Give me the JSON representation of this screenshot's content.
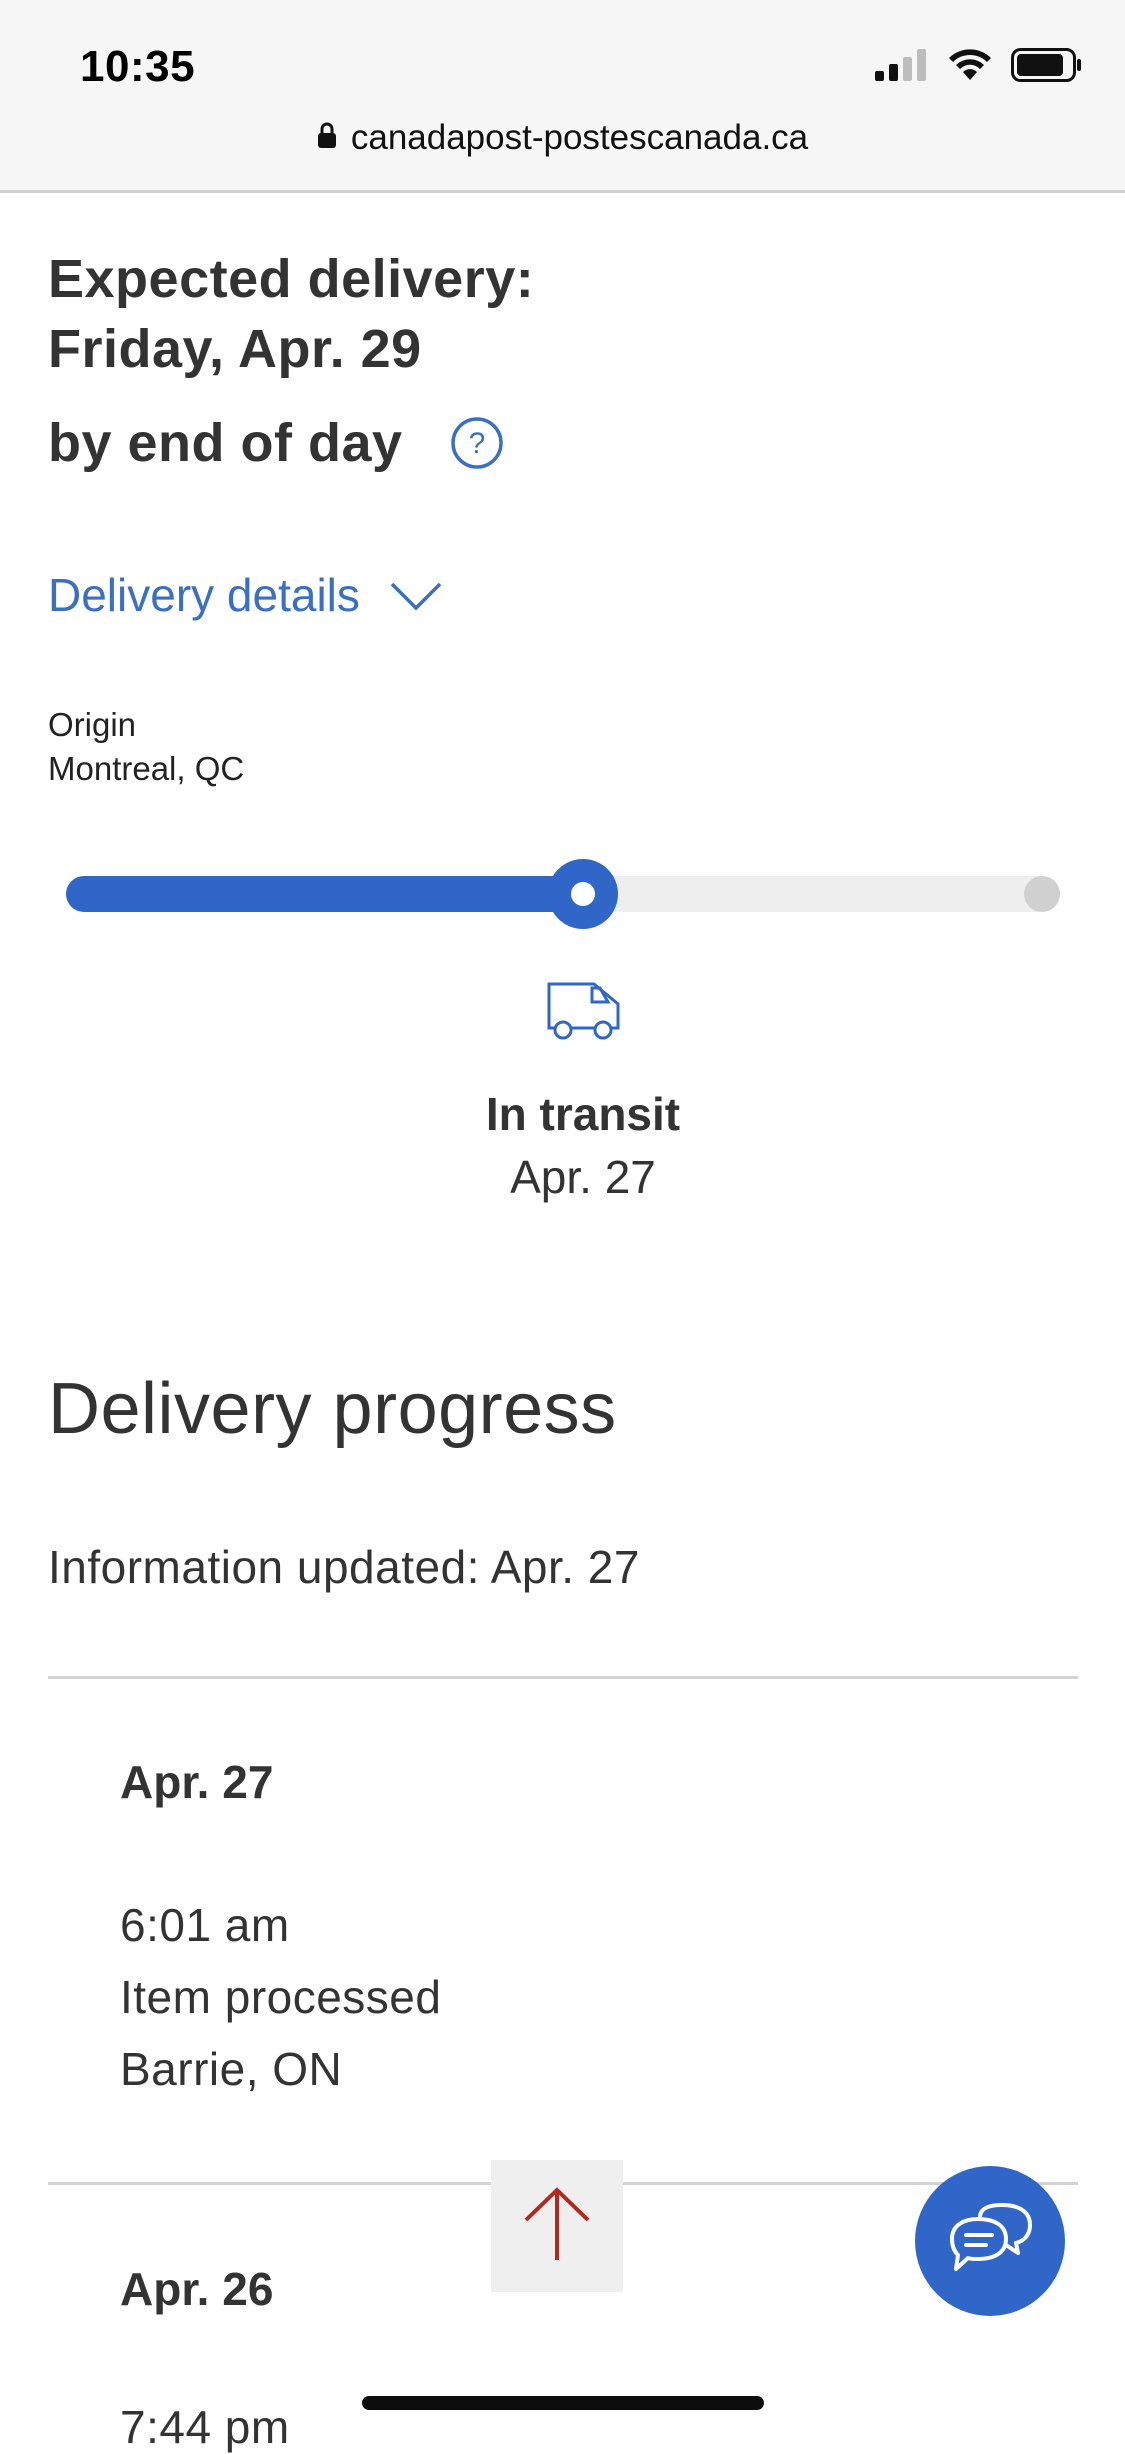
{
  "status_bar": {
    "time": "10:35",
    "icons": [
      "cellular-signal-icon",
      "wifi-icon",
      "battery-icon"
    ]
  },
  "browser": {
    "url": "canadapost-postescanada.ca",
    "icon": "lock-icon"
  },
  "delivery": {
    "expected_label": "Expected delivery:",
    "expected_date": "Friday, Apr. 29",
    "expected_time": "by end of day",
    "help_icon": "question-circle-icon",
    "details_link": "Delivery details",
    "details_icon": "chevron-down-icon",
    "origin_label": "Origin",
    "origin_value": "Montreal, QC",
    "progress_fraction": 0.52,
    "status_icon": "delivery-truck-icon",
    "status_title": "In transit",
    "status_date": "Apr. 27"
  },
  "progress_section": {
    "heading": "Delivery progress",
    "updated": "Information updated: Apr. 27",
    "events": [
      {
        "date": "Apr. 27",
        "time": "6:01 am",
        "description": "Item processed",
        "location": "Barrie, ON"
      },
      {
        "date": "Apr. 26",
        "time": "7:44 pm"
      }
    ]
  },
  "floating": {
    "back_to_top_icon": "arrow-up-icon",
    "chat_icon": "chat-bubbles-icon"
  },
  "colors": {
    "accent": "#2f66c7",
    "link": "#3a6fc4",
    "back_to_top_arrow": "#b3271e"
  }
}
